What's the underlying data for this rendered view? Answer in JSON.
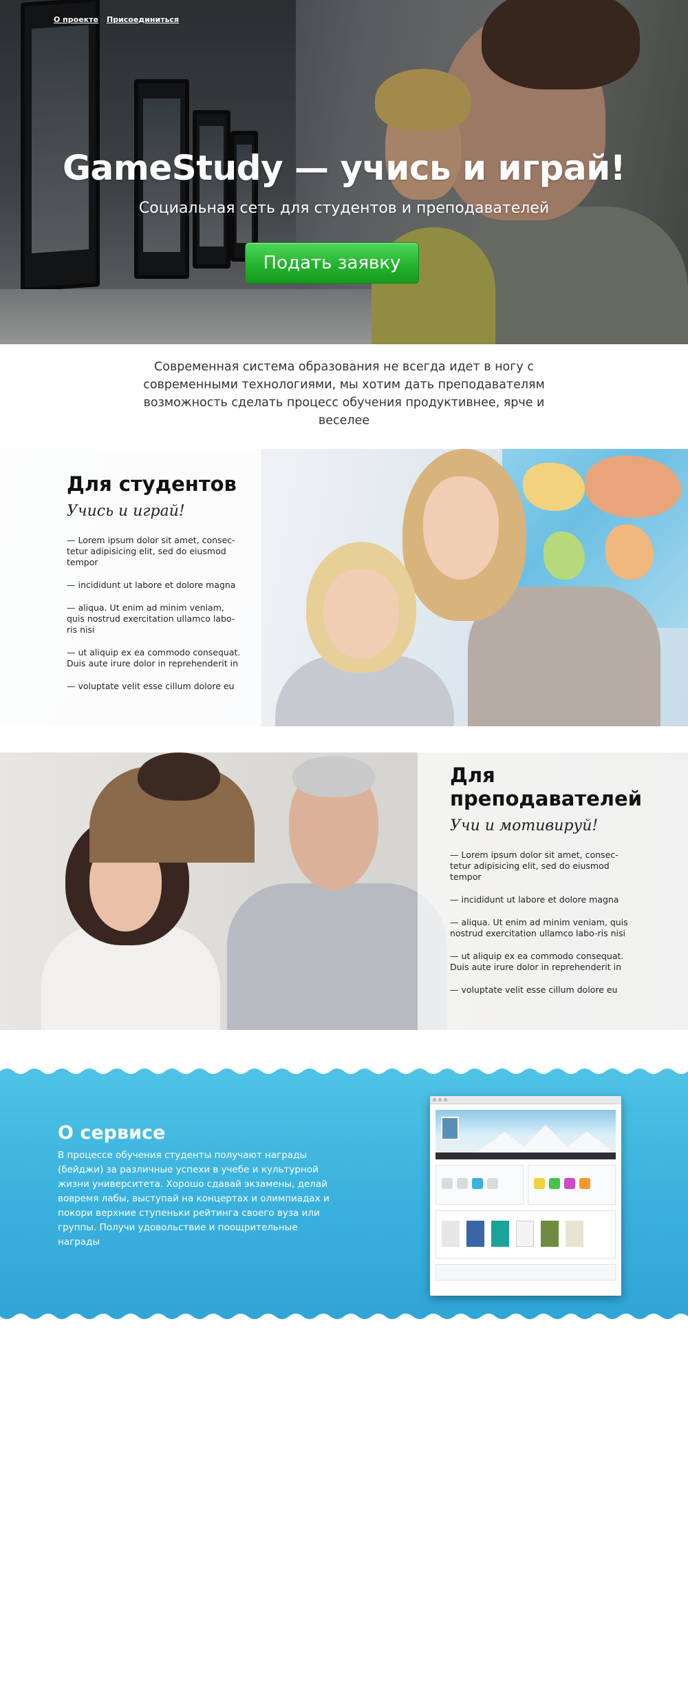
{
  "nav": {
    "about": "О проекте",
    "join": "Присоединиться"
  },
  "hero": {
    "title": "GameStudy — учись и играй!",
    "subtitle": "Социальная сеть для студентов и преподавателей",
    "cta": "Подать заявку"
  },
  "intro": {
    "text": "Современная система образования не всегда идет в ногу с современными технологиями, мы хотим дать преподавателям возможность сделать процесс обучения продуктивнее, ярче и веселее"
  },
  "students": {
    "title": "Для студентов",
    "tagline": "Учись и играй!",
    "items": [
      "— Lorem ipsum dolor sit amet, consec-tetur adipisicing elit, sed do eiusmod tempor",
      "— incididunt ut labore et dolore magna",
      "— aliqua. Ut enim ad minim veniam, quis nostrud exercitation ullamco labo-ris nisi",
      "— ut aliquip ex ea commodo consequat. Duis aute irure dolor in reprehenderit in",
      "— voluptate velit esse cillum dolore eu"
    ]
  },
  "teachers": {
    "title": "Для преподавателей",
    "tagline": "Учи и мотивируй!",
    "items": [
      "— Lorem ipsum dolor sit amet, consec-tetur adipisicing elit, sed do eiusmod tempor",
      "— incididunt ut labore et dolore magna",
      "— aliqua. Ut enim ad minim veniam, quis nostrud exercitation ullamco labo-ris nisi",
      "— ut aliquip ex ea commodo consequat. Duis aute irure dolor in reprehenderit in",
      "— voluptate velit esse cillum dolore eu"
    ]
  },
  "service": {
    "title": "О сервисе",
    "text": "В процессе обучения студенты получают награды (бейджи) за различные успехи в учебе и культурной жизни университета. Хорошо сдавай экзамены, делай вовремя лабы, выступай на концертах и олимпиадах и покори верхние ступеньки рейтинга своего вуза или группы. Получи удовольствие и поощрительные награды"
  },
  "colors": {
    "cta_green": "#25b32e",
    "service_blue": "#3bb2dd",
    "text_dark": "#222222"
  }
}
